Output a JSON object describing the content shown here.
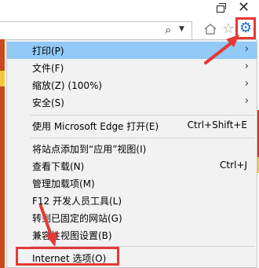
{
  "menu": {
    "items": [
      {
        "label": "打印(P)",
        "submenu": true
      },
      {
        "label": "文件(F)",
        "submenu": true
      },
      {
        "label": "缩放(Z) (100%)",
        "submenu": true
      },
      {
        "label": "安全(S)",
        "submenu": true
      },
      {
        "label": "使用 Microsoft Edge 打开(E)",
        "shortcut": "Ctrl+Shift+E"
      },
      {
        "label": "将站点添加到“应用”视图(I)"
      },
      {
        "label": "查看下载(N)",
        "shortcut": "Ctrl+J"
      },
      {
        "label": "管理加载项(M)"
      },
      {
        "label": "F12 开发人员工具(L)"
      },
      {
        "label": "转到已固定的网站(G)"
      },
      {
        "label": "兼容性视图设置(B)"
      },
      {
        "label": "Internet 选项(O)"
      }
    ]
  },
  "colors": {
    "highlight": "#91c9f7",
    "annotation_red": "#e53935",
    "gear_blue": "#1a6fc4"
  },
  "icons": {
    "submenu_arrow": "›"
  }
}
